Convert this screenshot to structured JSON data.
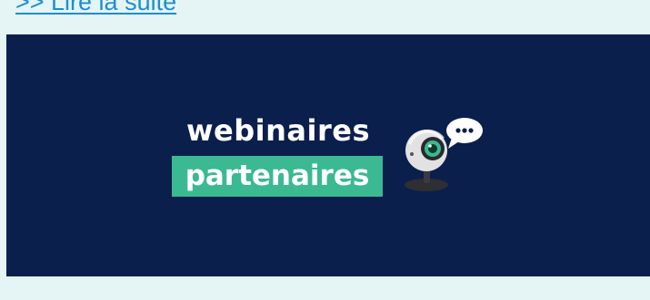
{
  "article": {
    "read_more_label": ">> Lire la suite"
  },
  "banner": {
    "title_line1": "webinaires",
    "title_line2": "partenaires",
    "icon": "webcam-chat-icon",
    "colors": {
      "background": "#0b1f4d",
      "highlight": "#3bb990",
      "text": "#ffffff"
    }
  }
}
